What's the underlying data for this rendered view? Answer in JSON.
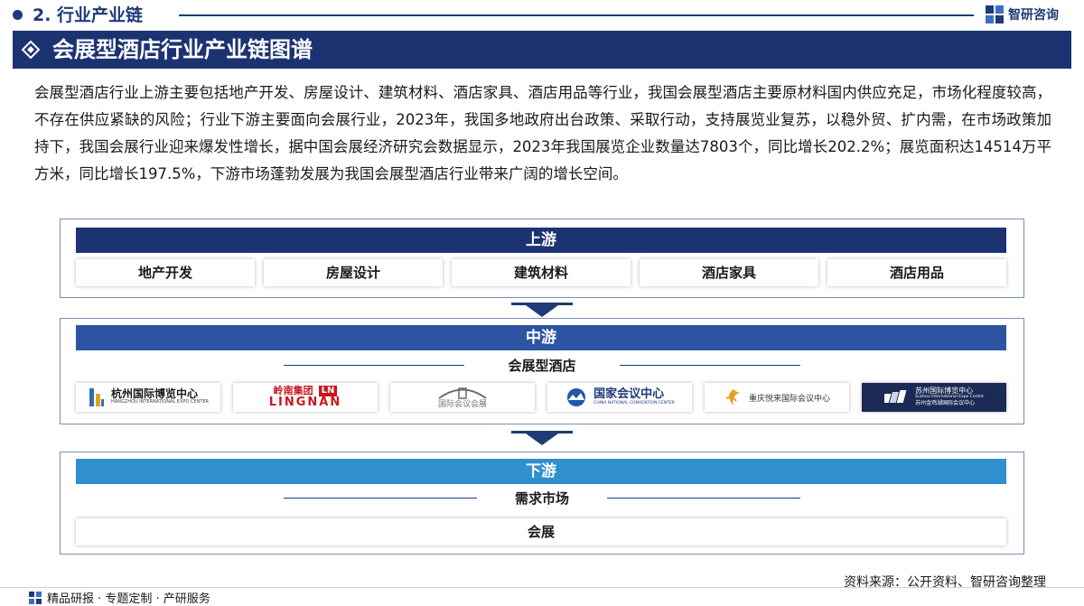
{
  "section": {
    "title": "2. 行业产业链"
  },
  "brand": {
    "name": "智研咨询"
  },
  "title": "会展型酒店行业产业链图谱",
  "intro": "会展型酒店行业上游主要包括地产开发、房屋设计、建筑材料、酒店家具、酒店用品等行业，我国会展型酒店主要原材料国内供应充足，市场化程度较高，不存在供应紧缺的风险；行业下游主要面向会展行业，2023年，我国多地政府出台政策、采取行动，支持展览业复苏，以稳外贸、扩内需，在市场政策加持下，我国会展行业迎来爆发性增长，据中国会展经济研究会数据显示，2023年我国展览企业数量达7803个，同比增长202.2%；展览面积达14514万平方米，同比增长197.5%，下游市场蓬勃发展为我国会展型酒店行业带来广阔的增长空间。",
  "upstream": {
    "label": "上游",
    "items": [
      "地产开发",
      "房屋设计",
      "建筑材料",
      "酒店家具",
      "酒店用品"
    ]
  },
  "midstream": {
    "label": "中游",
    "subheading": "会展型酒店",
    "logos": [
      {
        "name": "杭州国际博览中心",
        "sub": "HANGZHOU INTERNATIONAL EXPO CENTER",
        "icon": "hangzhou-expo-logo-icon"
      },
      {
        "name": "岭南集团",
        "sub": "LINGNAN",
        "badge": "LN",
        "icon": "lingnan-logo-icon"
      },
      {
        "name": "国际会议会展",
        "sub": "",
        "icon": "convention-arch-logo-icon"
      },
      {
        "name": "国家会议中心",
        "sub": "CHINA NATIONAL CONVENTION CENTER",
        "icon": "cncc-logo-icon"
      },
      {
        "name": "重庆悦来国际会议中心",
        "sub": "",
        "icon": "chongqing-yuelai-logo-icon"
      },
      {
        "name": "苏州国际博览中心",
        "sub": "Suzhou International Expo Centre",
        "sub2": "苏州金鸡湖国际会议中心",
        "icon": "suzhou-expo-logo-icon"
      }
    ]
  },
  "downstream": {
    "label": "下游",
    "subheading": "需求市场",
    "items": [
      "会展"
    ]
  },
  "footer": {
    "source": "资料来源：公开资料、智研咨询整理",
    "tagline": "精品研报 · 专题定制 · 产研服务"
  },
  "colors": {
    "navy": "#1c3372",
    "mid_blue": "#2d54a3",
    "light_blue": "#2f8fcf"
  }
}
